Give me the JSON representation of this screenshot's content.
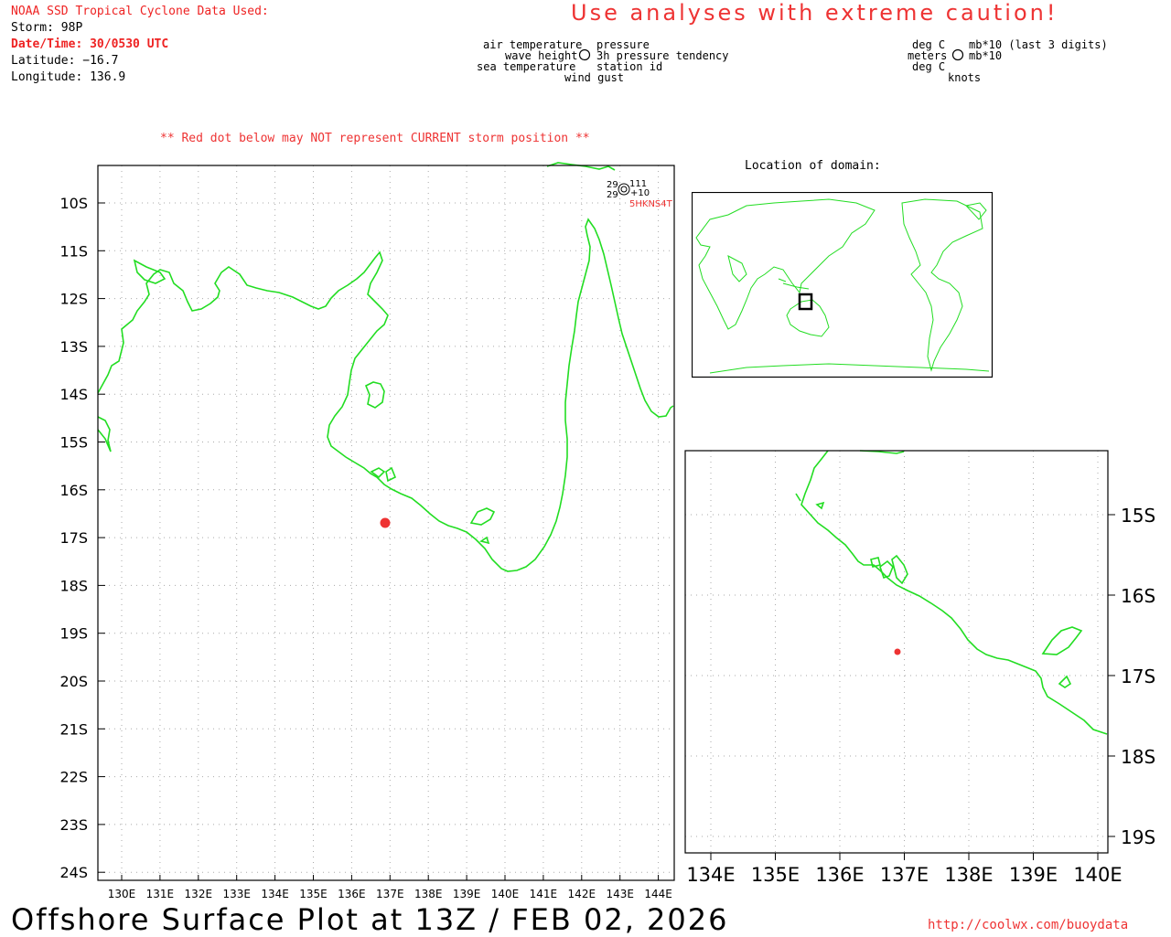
{
  "header": {
    "source": "NOAA SSD Tropical Cyclone Data Used:",
    "storm": "Storm: 98P",
    "datetime": "Date/Time: 30/0530 UTC",
    "latitude": "Latitude: −16.7",
    "longitude": "Longitude: 136.9",
    "caution": "Use analyses with extreme caution!"
  },
  "legend": {
    "left": [
      "air temperature",
      "wave height",
      "sea temperature"
    ],
    "right": [
      "pressure",
      "3h pressure tendency",
      "station id"
    ],
    "bottom": "wind gust",
    "units_left": [
      "deg C",
      "meters",
      "deg C"
    ],
    "units_right": [
      "mb*10 (last 3 digits)",
      "mb*10",
      ""
    ],
    "units_bottom": "knots"
  },
  "warning": "** Red dot below may NOT represent CURRENT storm position **",
  "main_map": {
    "lat_labels": [
      "10S",
      "11S",
      "12S",
      "13S",
      "14S",
      "15S",
      "16S",
      "17S",
      "18S",
      "19S",
      "20S",
      "21S",
      "22S",
      "23S",
      "24S"
    ],
    "lon_labels": [
      "130E",
      "131E",
      "132E",
      "133E",
      "134E",
      "135E",
      "136E",
      "137E",
      "138E",
      "139E",
      "140E",
      "141E",
      "142E",
      "143E",
      "144E"
    ],
    "station": {
      "air_temp": "29",
      "pressure": "111",
      "sea_temp": "29",
      "tendency": "+10",
      "id": "5HKNS4T"
    },
    "storm_position": {
      "lat": -16.7,
      "lon": 136.9
    },
    "colors": {
      "coast": "#22dd22",
      "storm": "#ee3333",
      "grid": "#999999"
    }
  },
  "inset_title": "Location of domain:",
  "zoom_map": {
    "lat_labels": [
      "15S",
      "16S",
      "17S",
      "18S",
      "19S"
    ],
    "lon_labels": [
      "134E",
      "135E",
      "136E",
      "137E",
      "138E",
      "139E",
      "140E"
    ]
  },
  "footer": {
    "title": "Offshore Surface Plot at 13Z / FEB 02, 2026",
    "url": "http://coolwx.com/buoydata"
  }
}
